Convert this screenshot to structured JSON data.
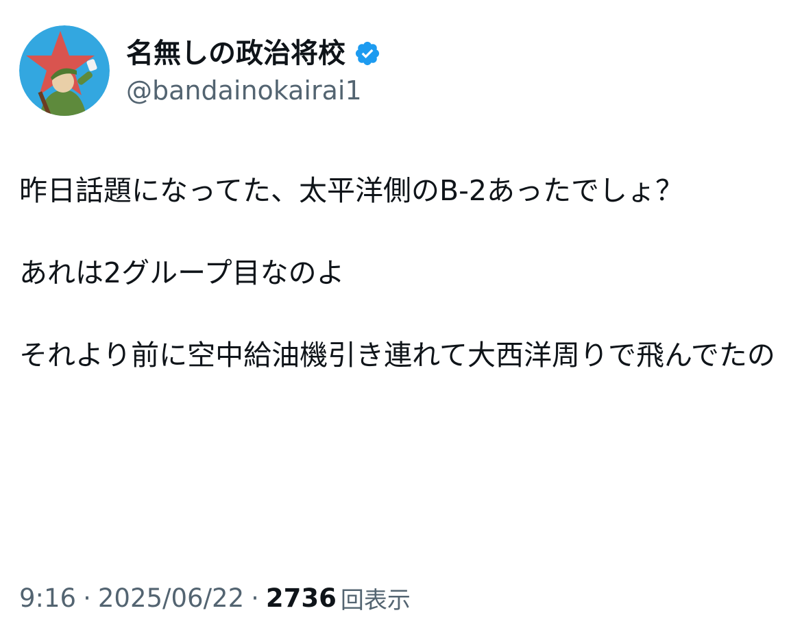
{
  "user": {
    "display_name": "名無しの政治将校",
    "handle": "@bandainokairai1",
    "verified_icon": "verified-badge-icon",
    "avatar_icon": "soldier-avatar-icon",
    "accent_color": "#1d9bf0"
  },
  "tweet": {
    "paragraphs": [
      "昨日話題になってた、太平洋側のB-2あったでしょ？",
      "あれは2グループ目なのよ",
      "それより前に空中給油機引き連れて大西洋周りで飛んでたの"
    ]
  },
  "meta": {
    "time": "9:16",
    "separator": "·",
    "date": "2025/06/22",
    "views_count": "2736",
    "views_label": "回表示"
  }
}
